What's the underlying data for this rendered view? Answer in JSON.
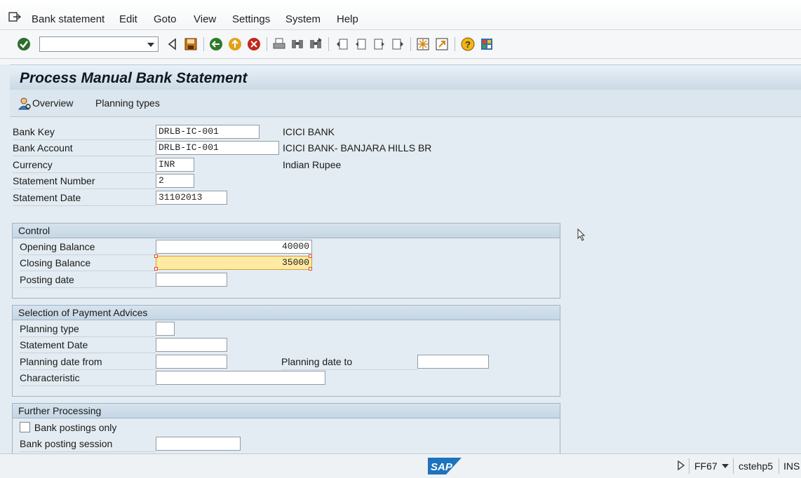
{
  "menu": {
    "items": [
      "Bank statement",
      "Edit",
      "Goto",
      "View",
      "Settings",
      "System",
      "Help"
    ]
  },
  "toolbar": {
    "command_field_value": "",
    "icons": [
      "enter-icon",
      "back-arrow-icon",
      "save-icon",
      "back-icon",
      "exit-icon",
      "cancel-icon",
      "print-icon",
      "find-icon",
      "find-next-icon",
      "first-page-icon",
      "previous-page-icon",
      "next-page-icon",
      "last-page-icon",
      "new-session-icon",
      "shortcut-icon",
      "help-icon",
      "customize-layout-icon"
    ]
  },
  "screen": {
    "title": "Process Manual Bank Statement",
    "app_buttons": {
      "overview": "Overview",
      "planning_types": "Planning types"
    }
  },
  "header_fields": {
    "bank_key": {
      "label": "Bank Key",
      "value": "DRLB-IC-001",
      "desc": "ICICI BANK"
    },
    "bank_account": {
      "label": "Bank Account",
      "value": "DRLB-IC-001",
      "desc": "ICICI BANK- BANJARA HILLS BR"
    },
    "currency": {
      "label": "Currency",
      "value": "INR",
      "desc": "Indian Rupee"
    },
    "statement_number": {
      "label": "Statement Number",
      "value": "2"
    },
    "statement_date": {
      "label": "Statement Date",
      "value": "31102013"
    }
  },
  "control": {
    "title": "Control",
    "opening_balance": {
      "label": "Opening Balance",
      "value": "40000"
    },
    "closing_balance": {
      "label": "Closing Balance",
      "value": "35000"
    },
    "posting_date": {
      "label": "Posting date",
      "value": ""
    }
  },
  "payment_advices": {
    "title": "Selection of Payment Advices",
    "planning_type": {
      "label": "Planning type",
      "value": ""
    },
    "statement_date": {
      "label": "Statement Date",
      "value": ""
    },
    "planning_date_from": {
      "label": "Planning date from",
      "value": ""
    },
    "planning_date_to": {
      "label": "Planning date to",
      "value": ""
    },
    "characteristic": {
      "label": "Characteristic",
      "value": ""
    }
  },
  "further_processing": {
    "title": "Further Processing",
    "bank_postings_only": {
      "label": "Bank postings only",
      "checked": false
    },
    "bank_posting_session": {
      "label": "Bank posting session",
      "value": ""
    }
  },
  "status": {
    "transaction": "FF67",
    "server": "cstehp5",
    "mode": "INS"
  },
  "colors": {
    "background": "#e3ecf2",
    "highlight_field": "#ffe9a3",
    "sap_logo_blue": "#1e73be"
  }
}
